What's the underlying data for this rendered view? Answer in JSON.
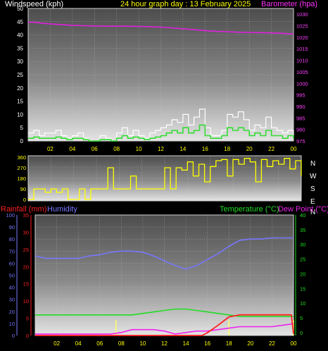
{
  "chart_data": [
    {
      "type": "line",
      "title": "24 hour graph day : 13 February 2025",
      "left_axis_label": "Windspeed (kph)",
      "right_axis_label": "Barometer (hpa)",
      "x_ticks": [
        "02",
        "04",
        "06",
        "08",
        "10",
        "12",
        "14",
        "16",
        "18",
        "20",
        "22",
        "00"
      ],
      "left_ticks": [
        "0",
        "5",
        "10",
        "15",
        "20",
        "25",
        "30",
        "35",
        "40",
        "45",
        "50"
      ],
      "right_ticks": [
        "975",
        "980",
        "985",
        "990",
        "995",
        "1000",
        "1005",
        "1010",
        "1015",
        "1020",
        "1025",
        "1030"
      ],
      "ylim_left": [
        0,
        50
      ],
      "ylim_right": [
        975,
        1032.5
      ],
      "colors": {
        "title": "#ffff00",
        "left_label": "#ffffff",
        "right_label": "#ff33ff",
        "gust": "#ffffff",
        "wind": "#33dd33",
        "barometer": "#e020e0",
        "tick_left": "#ffffff",
        "tick_right": "#ff40ff",
        "tick_x": "#ffff00"
      },
      "series": [
        {
          "name": "Barometer (hpa)",
          "axis": "right",
          "x": [
            0,
            0.5,
            1,
            1.5,
            2,
            3,
            4,
            5,
            6,
            7,
            8,
            9,
            10,
            11,
            12,
            13,
            14,
            15,
            16,
            17,
            18,
            19,
            20,
            21,
            22,
            23,
            24
          ],
          "values": [
            1026.5,
            1026.5,
            1026.3,
            1026.0,
            1025.8,
            1025.5,
            1025.2,
            1025.0,
            1024.9,
            1024.8,
            1024.8,
            1024.8,
            1024.7,
            1024.6,
            1024.4,
            1024.1,
            1023.7,
            1023.3,
            1022.9,
            1022.6,
            1022.4,
            1022.2,
            1022.1,
            1022.0,
            1021.9,
            1021.7,
            1021.4
          ]
        },
        {
          "name": "Gust",
          "axis": "left",
          "x": [
            0,
            0.5,
            1,
            1.5,
            2,
            2.5,
            3,
            3.5,
            4,
            4.5,
            5,
            5.5,
            6,
            6.5,
            7,
            7.5,
            8,
            8.5,
            9,
            9.5,
            10,
            10.5,
            11,
            11.5,
            12,
            12.5,
            13,
            13.5,
            14,
            14.5,
            15,
            15.5,
            16,
            16.5,
            17,
            17.5,
            18,
            18.5,
            19,
            19.5,
            20,
            20.5,
            21,
            21.5,
            22,
            22.5,
            23,
            23.5,
            24
          ],
          "values": [
            3,
            4,
            2,
            3,
            3,
            4,
            2,
            1,
            2,
            3,
            1,
            0,
            0,
            2,
            1,
            0,
            3,
            5,
            2,
            4,
            2,
            1,
            3,
            4,
            5,
            6,
            8,
            7,
            10,
            6,
            9,
            12,
            5,
            2,
            2,
            4,
            10,
            9,
            11,
            8,
            4,
            6,
            5,
            9,
            5,
            4,
            3,
            4,
            2
          ]
        },
        {
          "name": "Wind",
          "axis": "left",
          "x": [
            0,
            0.5,
            1,
            1.5,
            2,
            2.5,
            3,
            3.5,
            4,
            4.5,
            5,
            5.5,
            6,
            6.5,
            7,
            7.5,
            8,
            8.5,
            9,
            9.5,
            10,
            10.5,
            11,
            11.5,
            12,
            12.5,
            13,
            13.5,
            14,
            14.5,
            15,
            15.5,
            16,
            16.5,
            17,
            17.5,
            18,
            18.5,
            19,
            19.5,
            20,
            20.5,
            21,
            21.5,
            22,
            22.5,
            23,
            23.5,
            24
          ],
          "values": [
            1,
            1.5,
            1,
            1,
            1,
            1.5,
            1,
            0.5,
            1,
            1,
            0.5,
            0,
            0,
            0.5,
            0.5,
            0,
            1,
            2,
            1,
            1.5,
            1,
            0.5,
            1,
            1.5,
            2,
            3,
            4,
            3,
            5,
            3,
            4,
            6,
            2,
            1,
            1,
            2,
            5,
            4,
            5,
            4,
            2,
            3,
            2,
            4,
            2,
            2,
            1,
            2,
            1
          ]
        }
      ]
    },
    {
      "type": "line",
      "left_ticks": [
        "0",
        "90",
        "180",
        "270",
        "360"
      ],
      "direction_labels": [
        "N",
        "W",
        "S",
        "E",
        "N"
      ],
      "ylim": [
        0,
        360
      ],
      "colors": {
        "direction": "#ffff00",
        "tick": "#ffff00",
        "compass": "#ffffff"
      },
      "series": [
        {
          "name": "Wind direction",
          "x": [
            0,
            0.5,
            1,
            1.5,
            2,
            2.5,
            3,
            3.5,
            4,
            4.5,
            5,
            5.5,
            6,
            6.5,
            7,
            7.5,
            8,
            8.5,
            9,
            9.5,
            10,
            10.5,
            11,
            11.5,
            12,
            12.5,
            13,
            13.5,
            14,
            14.5,
            15,
            15.5,
            16,
            16.5,
            17,
            17.5,
            18,
            18.5,
            19,
            19.5,
            20,
            20.5,
            21,
            21.5,
            22,
            22.5,
            23,
            23.5,
            24
          ],
          "values": [
            0,
            90,
            90,
            60,
            90,
            60,
            90,
            0,
            0,
            90,
            0,
            90,
            90,
            90,
            270,
            90,
            90,
            90,
            200,
            90,
            90,
            90,
            90,
            90,
            270,
            90,
            270,
            250,
            320,
            200,
            300,
            150,
            280,
            330,
            340,
            200,
            340,
            300,
            350,
            320,
            150,
            340,
            280,
            330,
            300,
            350,
            260,
            330,
            200
          ]
        }
      ]
    },
    {
      "type": "line",
      "rain_label": "Rainfall (mm)",
      "humidity_label": "Humidity",
      "temp_label": "Temperature (°C)",
      "dew_label": "Dew Point (°C)",
      "x_ticks": [
        "02",
        "04",
        "06",
        "08",
        "10",
        "12",
        "14",
        "16",
        "18",
        "20",
        "22",
        "00"
      ],
      "humidity_ticks": [
        "0",
        "10",
        "20",
        "30",
        "40",
        "50",
        "60",
        "70",
        "80",
        "90",
        "100"
      ],
      "rain_ticks": [
        "0",
        "5",
        "10",
        "15",
        "20",
        "25",
        "30",
        "35"
      ],
      "temp_ticks": [
        "0",
        "5",
        "10",
        "15",
        "20",
        "25",
        "30",
        "35",
        "40"
      ],
      "ylim_humidity": [
        0,
        100
      ],
      "ylim_rain": [
        0,
        35
      ],
      "ylim_temp": [
        -1,
        40
      ],
      "colors": {
        "rain": "#ff2020",
        "humidity": "#7777ff",
        "temp": "#22dd22",
        "dew": "#ee22ee",
        "rain_label": "#ff2020",
        "humidity_label": "#7777ff",
        "temp_label": "#22dd22",
        "dew_label": "#ee22ee",
        "x_tick": "#ffff00"
      },
      "series": [
        {
          "name": "Humidity",
          "axis": "humidity",
          "x": [
            0,
            1,
            2,
            3,
            4,
            5,
            6,
            7,
            8,
            9,
            10,
            11,
            12,
            13,
            14,
            15,
            16,
            17,
            18,
            19,
            20,
            21,
            22,
            23,
            24
          ],
          "values": [
            66,
            64,
            64,
            64,
            64,
            66,
            67,
            69,
            70,
            70,
            69,
            66,
            62,
            58,
            55,
            58,
            63,
            68,
            74,
            79,
            80,
            80,
            81,
            81,
            81
          ]
        },
        {
          "name": "Temperature (°C)",
          "axis": "temp",
          "x": [
            0,
            1,
            2,
            3,
            4,
            5,
            6,
            7,
            8,
            9,
            10,
            11,
            12,
            13,
            14,
            15,
            16,
            17,
            18,
            19,
            20,
            21,
            22,
            23,
            24
          ],
          "values": [
            6,
            6,
            6,
            6,
            6,
            6,
            6,
            6,
            6,
            6,
            6.5,
            7,
            7.5,
            8,
            8,
            7.5,
            7,
            6.5,
            6,
            5.5,
            5.5,
            5.5,
            5.5,
            5.5,
            5.5
          ]
        },
        {
          "name": "Dew Point (°C)",
          "axis": "temp",
          "x": [
            0,
            1,
            2,
            3,
            4,
            5,
            6,
            7,
            8,
            9,
            10,
            11,
            12,
            13,
            14,
            15,
            16,
            17,
            18,
            19,
            20,
            21,
            22,
            23,
            24
          ],
          "values": [
            -0.5,
            -0.5,
            -0.5,
            -0.5,
            -0.5,
            -0.5,
            -0.5,
            -0.5,
            0,
            1,
            1,
            1,
            0.5,
            -0.5,
            0,
            0.5,
            0.5,
            1,
            1.5,
            2,
            2,
            2,
            2,
            2.5,
            3
          ]
        },
        {
          "name": "Rainfall (mm)",
          "axis": "rain",
          "x": [
            0,
            15.5,
            16,
            17,
            18,
            19,
            20,
            21,
            22,
            23,
            23.8,
            24
          ],
          "values": [
            0,
            0,
            0.8,
            3,
            5.4,
            6,
            6,
            6,
            6,
            6,
            6,
            0.5
          ]
        },
        {
          "name": "Rain rate",
          "axis": "rain",
          "x": [
            7.5,
            18,
            24
          ],
          "values": [
            2,
            2,
            2
          ]
        }
      ]
    }
  ]
}
